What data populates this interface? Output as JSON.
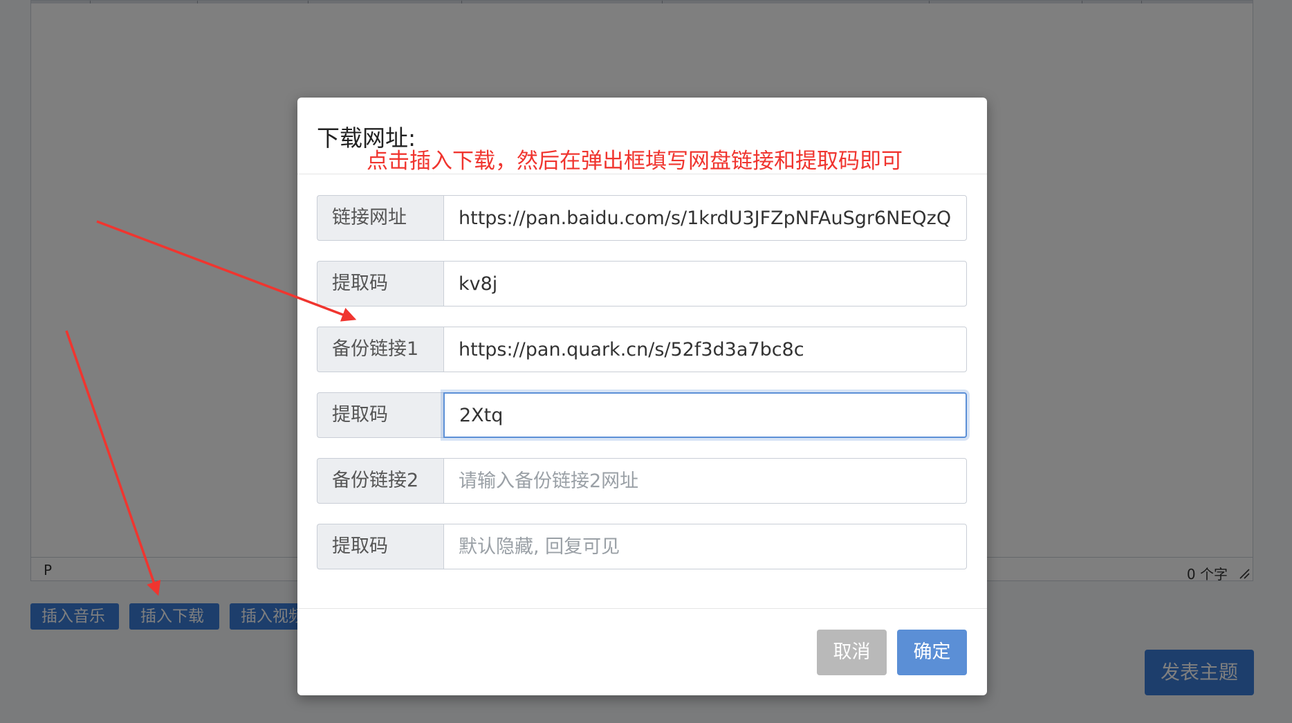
{
  "editor": {
    "status_path": "P",
    "word_count": "0 个字"
  },
  "buttons": {
    "insert_music": "插入音乐",
    "insert_download": "插入下载",
    "insert_video": "插入视频",
    "publish": "发表主题"
  },
  "modal": {
    "title": "下载网址:",
    "annotation": "点击插入下载，然后在弹出框填写网盘链接和提取码即可",
    "fields": [
      {
        "label": "链接网址",
        "value": "https://pan.baidu.com/s/1krdU3JFZpNFAuSgr6NEQzQ",
        "placeholder": ""
      },
      {
        "label": "提取码",
        "value": "kv8j",
        "placeholder": ""
      },
      {
        "label": "备份链接1",
        "value": "https://pan.quark.cn/s/52f3d3a7bc8c",
        "placeholder": ""
      },
      {
        "label": "提取码",
        "value": "2Xtq",
        "placeholder": ""
      },
      {
        "label": "备份链接2",
        "value": "",
        "placeholder": "请输入备份链接2网址"
      },
      {
        "label": "提取码",
        "value": "",
        "placeholder": "默认隐藏, 回复可见"
      }
    ],
    "cancel_label": "取消",
    "confirm_label": "确定"
  },
  "colors": {
    "annotation": "#f0352f",
    "primary": "#5b8fd6",
    "cancel": "#b9b9b9"
  }
}
